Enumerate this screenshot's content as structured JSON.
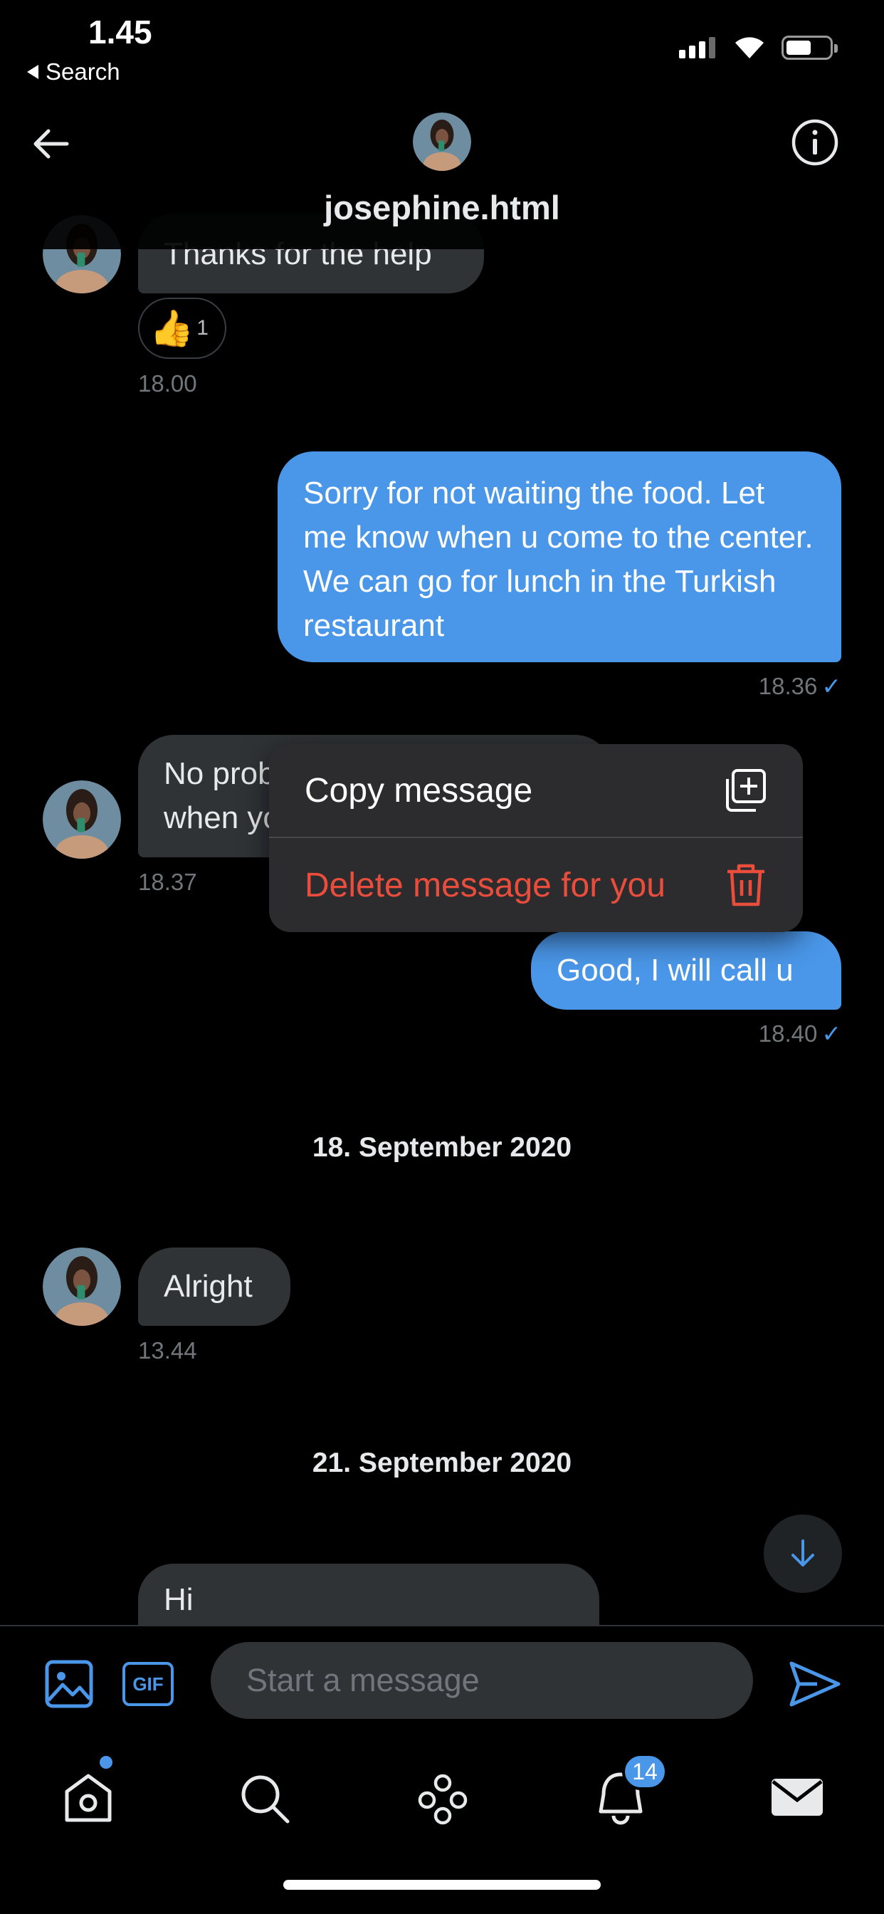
{
  "status_bar": {
    "time": "1.45",
    "back_label": "Search"
  },
  "header": {
    "name": "josephine.html"
  },
  "messages": {
    "m1": {
      "text": "Thanks for the help",
      "reaction_count": "1",
      "time": "18.00"
    },
    "m2": {
      "text": "Sorry for not waiting the food. Let me know when u come to the center. We can go for lunch in the Turkish restaurant",
      "time": "18.36"
    },
    "m3": {
      "text": "No problem, let me know when you are in the center",
      "time": "18.37"
    },
    "m4": {
      "text": "Good, I will call u",
      "time": "18.40"
    },
    "m5": {
      "text": "Alright",
      "time": "13.44"
    },
    "m6": {
      "text": "Hi"
    }
  },
  "dates": {
    "d1": "18. September 2020",
    "d2": "21. September 2020"
  },
  "context_menu": {
    "copy_label": "Copy message",
    "delete_label": "Delete message for you"
  },
  "composer": {
    "placeholder": "Start a message",
    "gif_label": "GIF"
  },
  "tabs": {
    "notifications_badge": "14"
  },
  "colors": {
    "accent": "#4a96e8",
    "danger": "#eb4d3d",
    "bubble_in": "#2f3336"
  }
}
